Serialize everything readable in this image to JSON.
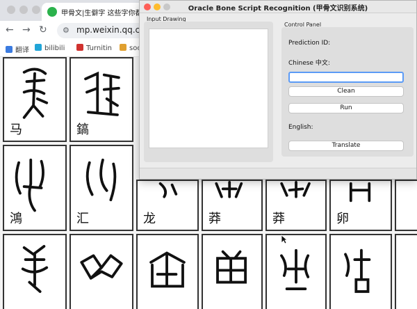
{
  "browser": {
    "tab_title": "甲骨文|生僻字 这些字你都认识",
    "url": "mp.weixin.qq.com/s",
    "bookmarks": [
      {
        "label": "翻译",
        "color": "#3b7be0"
      },
      {
        "label": "bilibili",
        "color": "#21a5d8"
      },
      {
        "label": "Turnitin",
        "color": "#d0322f"
      },
      {
        "label": "socrative",
        "color": "#e0a030"
      }
    ],
    "nav_icons": [
      "back-arrow-icon",
      "forward-arrow-icon",
      "reload-icon"
    ],
    "glyph_cells": [
      {
        "caption": "马"
      },
      {
        "caption": "鎬"
      },
      {
        "caption": "鴻"
      },
      {
        "caption": "汇"
      },
      {
        "caption": "龙"
      },
      {
        "caption": "莽"
      },
      {
        "caption": "莽"
      },
      {
        "caption": "卵"
      },
      {
        "caption": ""
      },
      {
        "caption": ""
      },
      {
        "caption": ""
      },
      {
        "caption": ""
      },
      {
        "caption": ""
      },
      {
        "caption": ""
      },
      {
        "caption": ""
      },
      {
        "caption": ""
      }
    ]
  },
  "app": {
    "title": "Oracle Bone Script Recognition (甲骨文识别系统)",
    "input_group_label": "Input Drawing",
    "control_group_label": "Control Panel",
    "prediction_label": "Prediction ID:",
    "chinese_label": "Chinese 中文:",
    "chinese_value": "",
    "clean_label": "Clean",
    "run_label": "Run",
    "english_label": "English:",
    "translate_label": "Translate",
    "light_colors": {
      "close": "#fe5f57",
      "minimize": "#febc2e",
      "zoom": "#c8c8c8"
    }
  }
}
